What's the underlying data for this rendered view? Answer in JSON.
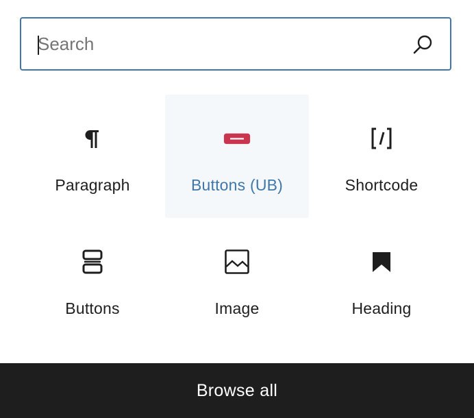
{
  "search": {
    "placeholder": "Search",
    "value": "",
    "icon": "search-icon"
  },
  "colors": {
    "accent": "#3f77a8",
    "buttons_ub_icon": "#c9344e",
    "footer_background": "#1e1e1e",
    "active_tile_background": "#f5f8fb"
  },
  "blocks": [
    {
      "label": "Paragraph",
      "icon": "paragraph-icon",
      "active": false
    },
    {
      "label": "Buttons (UB)",
      "icon": "button-ub-icon",
      "active": true
    },
    {
      "label": "Shortcode",
      "icon": "shortcode-icon",
      "active": false
    },
    {
      "label": "Buttons",
      "icon": "buttons-icon",
      "active": false
    },
    {
      "label": "Image",
      "icon": "image-icon",
      "active": false
    },
    {
      "label": "Heading",
      "icon": "heading-bookmark-icon",
      "active": false
    }
  ],
  "footer": {
    "label": "Browse all"
  }
}
